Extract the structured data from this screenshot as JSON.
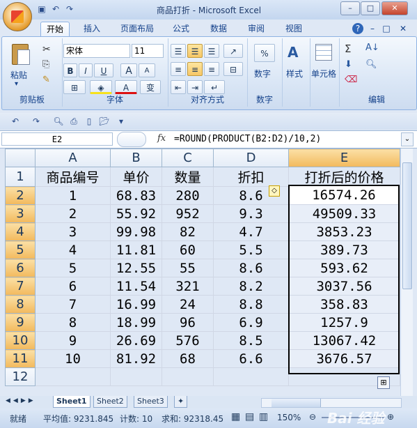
{
  "window": {
    "title": "商品打折 - Microsoft Excel",
    "minimize": "–",
    "restore": "□",
    "close": "✕"
  },
  "ribbon_tabs": [
    "开始",
    "插入",
    "页面布局",
    "公式",
    "数据",
    "审阅",
    "视图"
  ],
  "ribbon_right": {
    "help": "?",
    "min": "–",
    "restore": "□",
    "close": "✕"
  },
  "ribbon": {
    "clipboard": {
      "label": "剪贴板",
      "paste": "粘贴"
    },
    "font": {
      "label": "字体",
      "name": "宋体",
      "size": "11",
      "bold": "B",
      "italic": "I",
      "underline": "U",
      "grow": "A",
      "shrink": "A",
      "color_a": "A",
      "wen": "变"
    },
    "alignment": {
      "label": "对齐方式"
    },
    "number": {
      "label": "数字",
      "percent": "%",
      "title": "数字"
    },
    "styles": {
      "label": "样式"
    },
    "cells": {
      "label": "单元格"
    },
    "editing": {
      "label": "编辑",
      "sum": "Σ"
    }
  },
  "formula_bar": {
    "name_box": "E2",
    "fx": "fx",
    "formula": "=ROUND(PRODUCT(B2:D2)/10,2)"
  },
  "columns": [
    "A",
    "B",
    "C",
    "D",
    "E"
  ],
  "rows": [
    "1",
    "2",
    "3",
    "4",
    "5",
    "6",
    "7",
    "8",
    "9",
    "10",
    "11",
    "12"
  ],
  "table": {
    "headers": [
      "商品编号",
      "单价",
      "数量",
      "折扣",
      "打折后的价格"
    ],
    "data": [
      [
        "1",
        "68.83",
        "280",
        "8.6",
        "16574.26"
      ],
      [
        "2",
        "55.92",
        "952",
        "9.3",
        "49509.33"
      ],
      [
        "3",
        "99.98",
        "82",
        "4.7",
        "3853.23"
      ],
      [
        "4",
        "11.81",
        "60",
        "5.5",
        "389.73"
      ],
      [
        "5",
        "12.55",
        "55",
        "8.6",
        "593.62"
      ],
      [
        "6",
        "11.54",
        "321",
        "8.2",
        "3037.56"
      ],
      [
        "7",
        "16.99",
        "24",
        "8.8",
        "358.83"
      ],
      [
        "8",
        "18.99",
        "96",
        "6.9",
        "1257.9"
      ],
      [
        "9",
        "26.69",
        "576",
        "8.5",
        "13067.42"
      ],
      [
        "10",
        "81.92",
        "68",
        "6.6",
        "3676.57"
      ]
    ]
  },
  "sheets": [
    "Sheet1",
    "Sheet2",
    "Sheet3"
  ],
  "status": {
    "ready": "就绪",
    "average": "平均值: 9231.845",
    "count": "计数: 10",
    "sum": "求和: 92318.45",
    "zoom": "150%"
  },
  "watermark": "Bai 经验",
  "colors": {
    "selected_header": "#f2b95d",
    "ribbon_text": "#15428b"
  }
}
